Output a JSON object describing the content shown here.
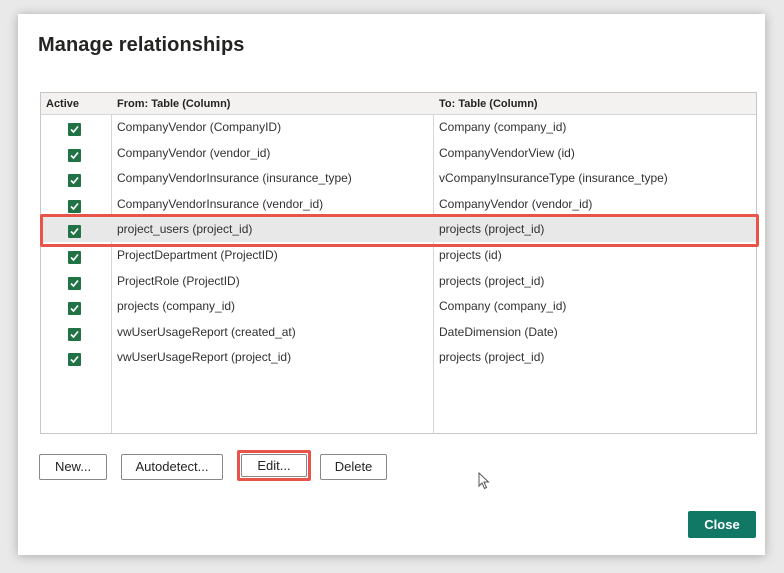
{
  "dialog": {
    "title": "Manage relationships"
  },
  "table": {
    "headers": {
      "active": "Active",
      "from": "From: Table (Column)",
      "to": "To: Table (Column)"
    },
    "rows": [
      {
        "active": true,
        "from": "CompanyVendor (CompanyID)",
        "to": "Company (company_id)"
      },
      {
        "active": true,
        "from": "CompanyVendor (vendor_id)",
        "to": "CompanyVendorView (id)"
      },
      {
        "active": true,
        "from": "CompanyVendorInsurance (insurance_type)",
        "to": "vCompanyInsuranceType (insurance_type)"
      },
      {
        "active": true,
        "from": "CompanyVendorInsurance (vendor_id)",
        "to": "CompanyVendor (vendor_id)"
      },
      {
        "active": true,
        "from": "project_users (project_id)",
        "to": "projects (project_id)",
        "selected": true
      },
      {
        "active": true,
        "from": "ProjectDepartment (ProjectID)",
        "to": "projects (id)"
      },
      {
        "active": true,
        "from": "ProjectRole (ProjectID)",
        "to": "projects (project_id)"
      },
      {
        "active": true,
        "from": "projects (company_id)",
        "to": "Company (company_id)"
      },
      {
        "active": true,
        "from": "vwUserUsageReport (created_at)",
        "to": "DateDimension (Date)"
      },
      {
        "active": true,
        "from": "vwUserUsageReport (project_id)",
        "to": "projects (project_id)"
      }
    ]
  },
  "buttons": {
    "new": "New...",
    "autodetect": "Autodetect...",
    "edit": "Edit...",
    "delete": "Delete",
    "close": "Close"
  },
  "colors": {
    "checkbox": "#217346",
    "highlight": "#e8534a",
    "primary": "#117865"
  },
  "icons": {
    "checkbox": "checkmark-icon",
    "cursor": "mouse-pointer-icon"
  }
}
